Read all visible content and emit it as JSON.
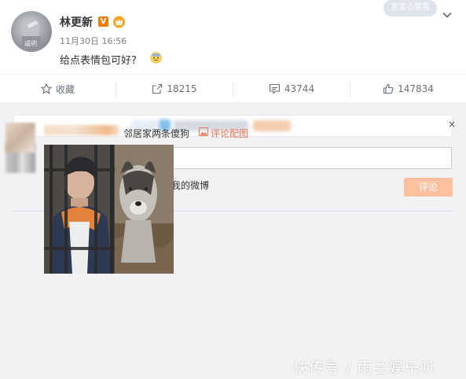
{
  "post": {
    "username": "林更新",
    "verified_badge": "V",
    "time": "11月30日 16:56",
    "text": "给点表情包可好?",
    "avatar_watermark": "戚明",
    "sticker_text": "宝宝心里苦"
  },
  "actions": {
    "favorite_label": "收藏",
    "share_count": "18215",
    "comment_count": "43744",
    "like_count": "147834"
  },
  "composer": {
    "notice_close": "×",
    "also_repost_label": "同时转发到我的微博",
    "submit_label": "评论",
    "input_value": ""
  },
  "comment": {
    "text": "邻居家两条傻狗",
    "pic_link_label": "评论配图"
  },
  "watermark": "快传号 / 雨兰娱乐听",
  "colors": {
    "accent_orange": "#eb7350",
    "submit_disabled": "#ffc09f",
    "badge_orange": "#f07c00"
  }
}
